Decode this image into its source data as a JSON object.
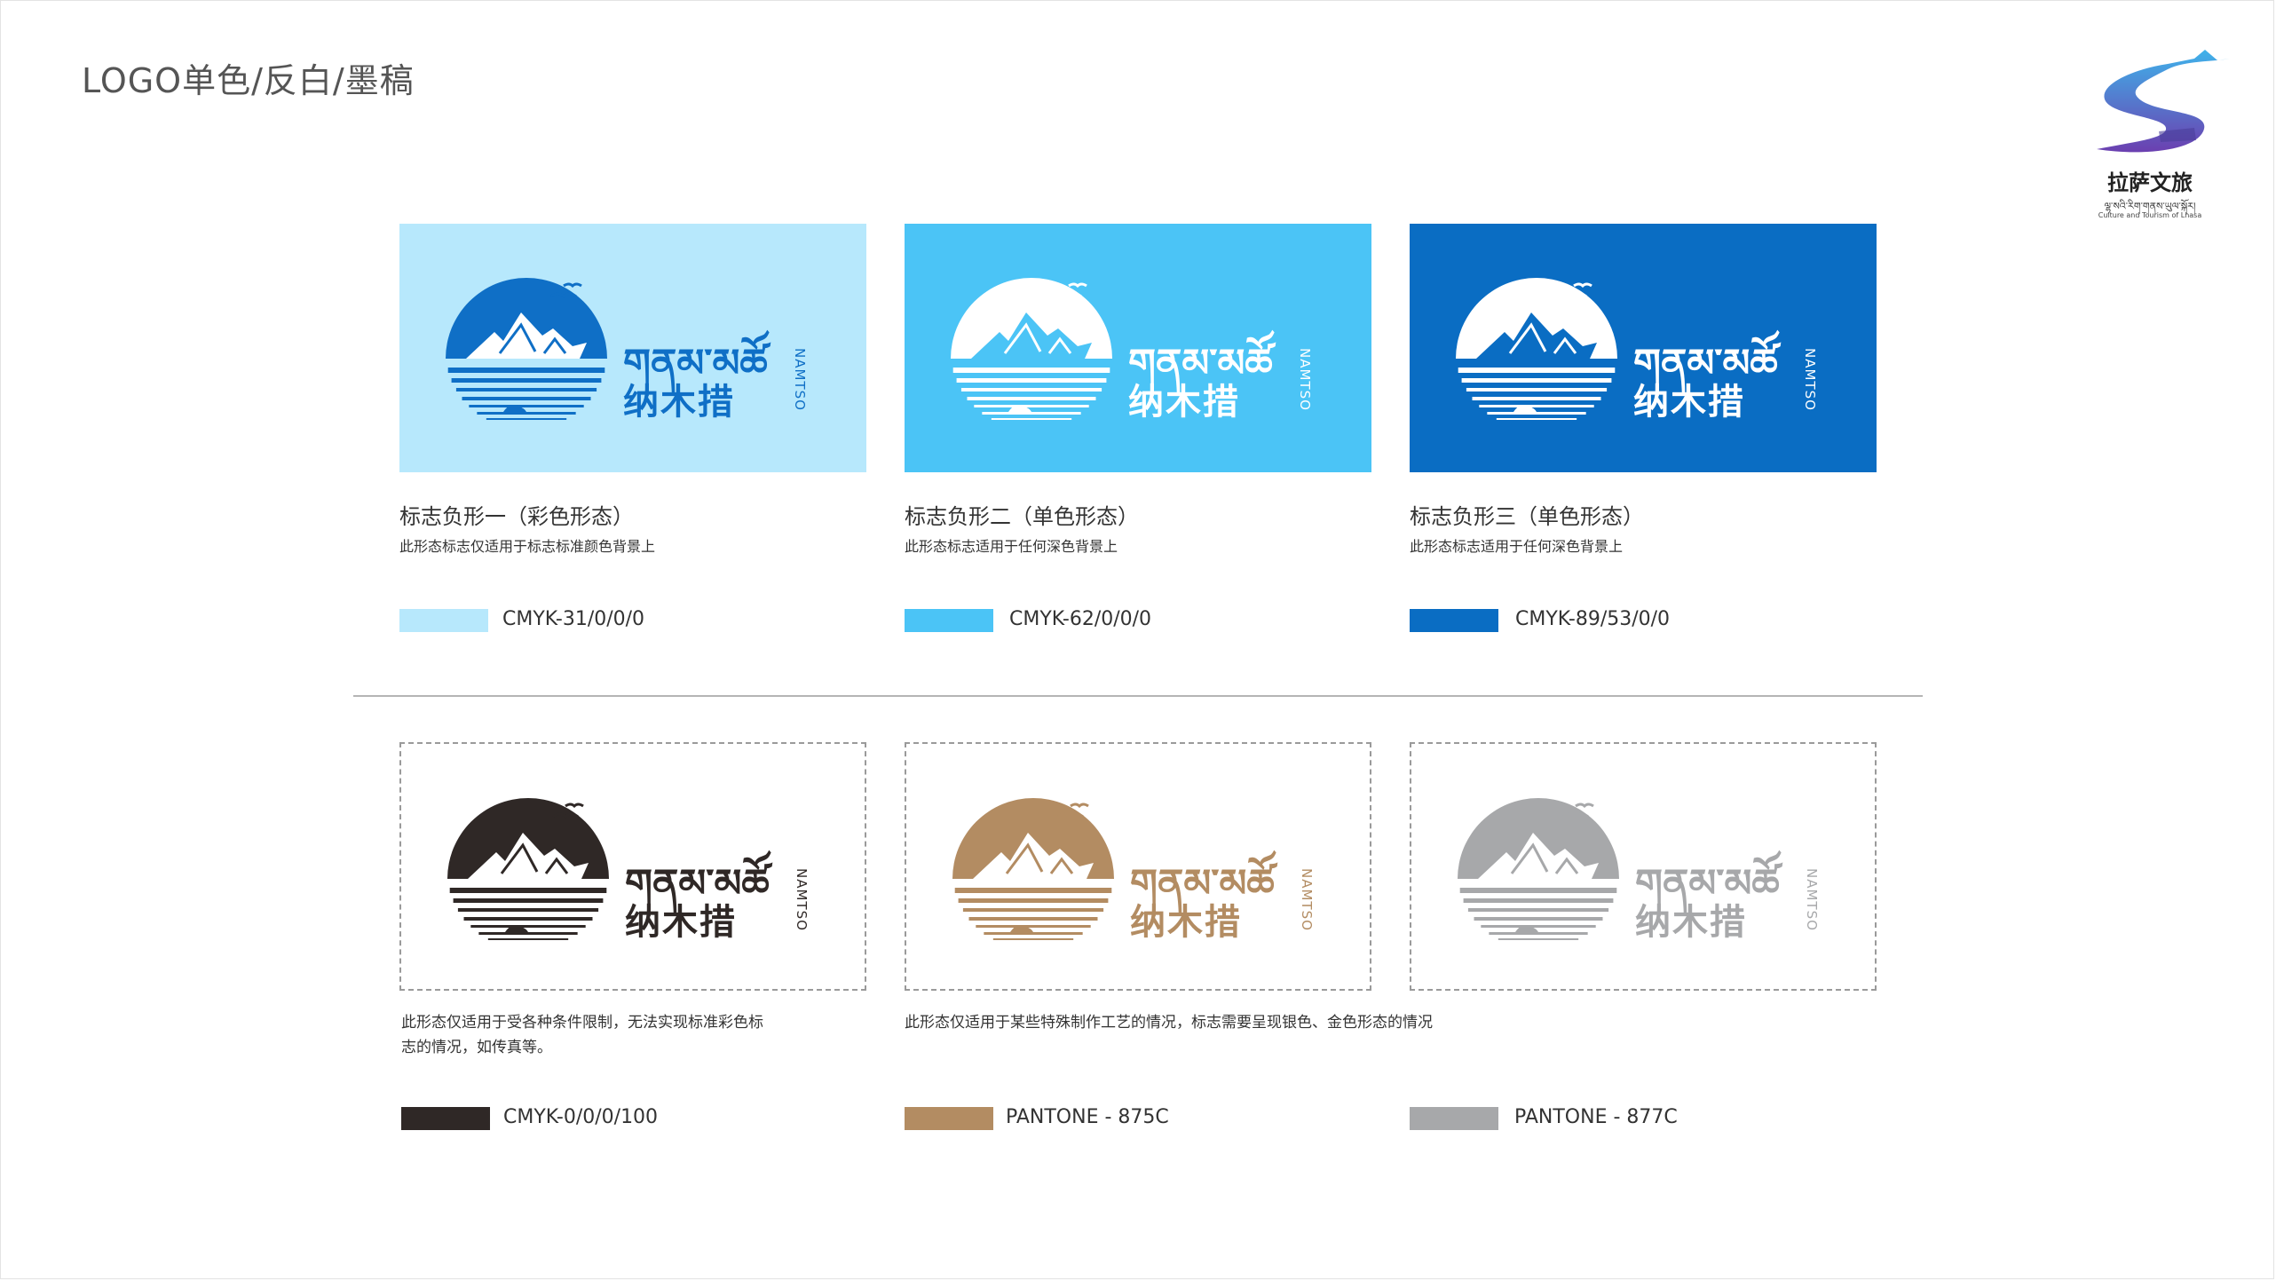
{
  "page": {
    "title": "LOGO单色/反白/墨稿"
  },
  "brand": {
    "name_cn": "拉萨文旅",
    "name_tibetan": "ལྷ་སའི་རིག་གནས་ཡུལ་སྐོར།",
    "name_en": "Culture and Tourism of Lhasa",
    "colors": {
      "ribbon_top": "#3fb3ea",
      "ribbon_bottom": "#6b3fb0"
    }
  },
  "logo": {
    "tibetan": "གནམ་མཚོ",
    "chinese": "纳木措",
    "english": "NAMTSO"
  },
  "top_cards": [
    {
      "title": "标志负形一（彩色形态）",
      "desc": "此形态标志仅适用于标志标准颜色背景上",
      "swatch_label": "CMYK-31/0/0/0",
      "colors": {
        "background": "#b7e8fc",
        "circle": "#0f6fc6",
        "text": "#0f6fc6",
        "mountain": "#ffffff",
        "swatch": "#b7e8fc"
      }
    },
    {
      "title": "标志负形二（单色形态）",
      "desc": "此形态标志适用于任何深色背景上",
      "swatch_label": "CMYK-62/0/0/0",
      "colors": {
        "background": "#4bc4f6",
        "circle": "#ffffff",
        "text": "#ffffff",
        "mountain": "#4bc4f6",
        "swatch": "#4bc4f6"
      }
    },
    {
      "title": "标志负形三（单色形态）",
      "desc": "此形态标志适用于任何深色背景上",
      "swatch_label": "CMYK-89/53/0/0",
      "colors": {
        "background": "#0a6dc3",
        "circle": "#ffffff",
        "text": "#ffffff",
        "mountain": "#0a6dc3",
        "swatch": "#0a6dc3"
      }
    }
  ],
  "bottom_cards": [
    {
      "swatch_label": "CMYK-0/0/0/100",
      "colors": {
        "circle": "#2f2826",
        "text": "#2f2826",
        "mountain": "#ffffff",
        "swatch": "#2f2826"
      }
    },
    {
      "swatch_label": "PANTONE - 875C",
      "colors": {
        "circle": "#b38c62",
        "text": "#b38c62",
        "mountain": "#ffffff",
        "swatch": "#b38c62"
      }
    },
    {
      "swatch_label": "PANTONE - 877C",
      "colors": {
        "circle": "#a7a8aa",
        "text": "#a7a8aa",
        "mountain": "#ffffff",
        "swatch": "#a7a8aa"
      }
    }
  ],
  "notes": {
    "ink_line1": "此形态仅适用于受各种条件限制，无法实现标准彩色标",
    "ink_line2": "志的情况，如传真等。",
    "metal": "此形态仅适用于某些特殊制作工艺的情况，标志需要呈现银色、金色形态的情况"
  }
}
